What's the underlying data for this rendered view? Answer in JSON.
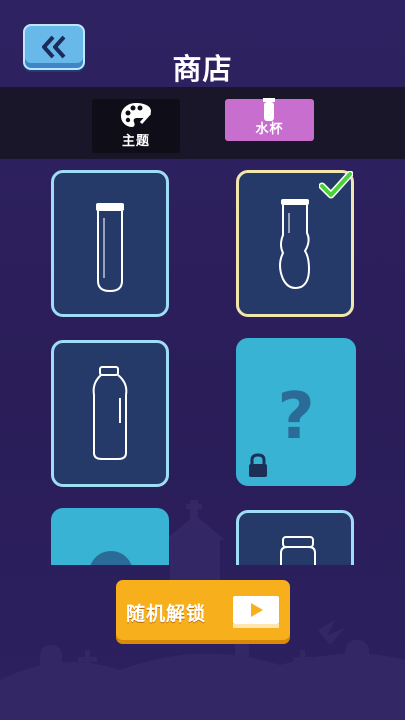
{
  "header": {
    "title": "商店",
    "back_icon": "double-chevron-left-icon"
  },
  "tabs": [
    {
      "label": "主题",
      "icon": "palette-icon",
      "active": false
    },
    {
      "label": "水杯",
      "icon": "cup-icon",
      "active": true
    }
  ],
  "items": [
    {
      "shape": "tall-tube",
      "status": "owned"
    },
    {
      "shape": "gourd-bottle",
      "status": "selected",
      "badge_icon": "checkmark-icon"
    },
    {
      "shape": "milk-bottle",
      "status": "owned"
    },
    {
      "shape": "mystery",
      "status": "locked",
      "icons": [
        "question-mark-icon",
        "padlock-icon"
      ]
    },
    {
      "shape": "locked-partial",
      "status": "locked"
    },
    {
      "shape": "jar",
      "status": "owned"
    }
  ],
  "actions": {
    "random_unlock_label": "随机解锁",
    "random_unlock_icon": "video-play-icon"
  },
  "colors": {
    "background": "#2b1f5c",
    "accent_blue": "#69b8ea",
    "card_border": "#9fdcf5",
    "selected_border": "#f1e7ad",
    "locked_card": "#39b3d4",
    "tab_active": "#c86ecf",
    "unlock_button": "#f7b01c",
    "check": "#4cd13b"
  }
}
